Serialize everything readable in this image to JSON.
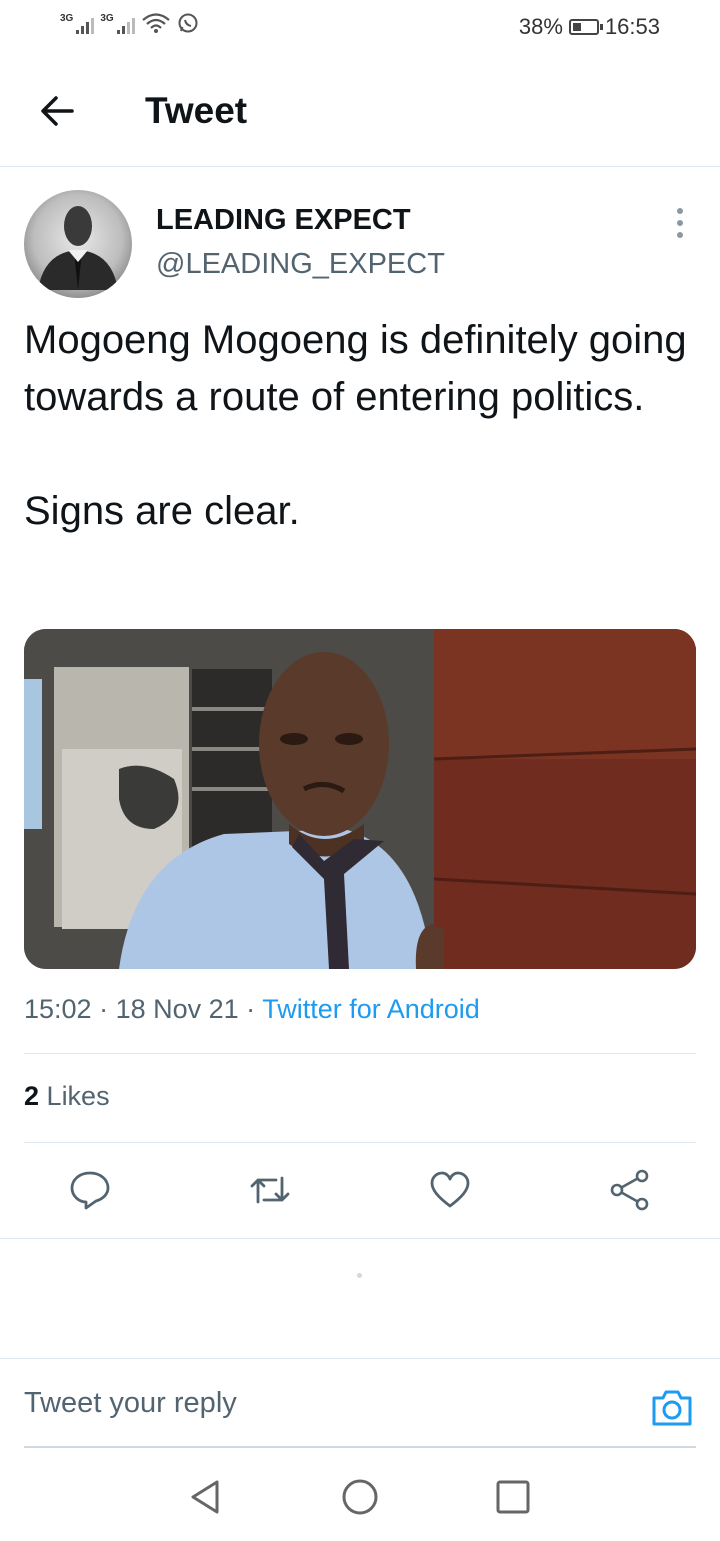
{
  "status_bar": {
    "signal1_label": "3G",
    "signal2_label": "3G",
    "battery_percent_text": "38%",
    "battery_level": 0.38,
    "time": "16:53"
  },
  "header": {
    "title": "Tweet"
  },
  "tweet": {
    "display_name": "LEADING EXPECT",
    "handle": "@LEADING_EXPECT",
    "text_line1": "Mogoeng Mogoeng is definitely going towards a route of entering politics.",
    "text_line2": "Signs are clear.",
    "time": "15:02",
    "date": "18 Nov 21",
    "source": "Twitter for Android",
    "likes_count": "2",
    "likes_label": "Likes"
  },
  "reply": {
    "placeholder": "Tweet your reply"
  },
  "icons": {
    "back": "arrow-left-icon",
    "more": "more-vertical-icon",
    "reply": "reply-icon",
    "retweet": "retweet-icon",
    "like": "heart-icon",
    "share": "share-icon",
    "camera": "camera-icon"
  },
  "colors": {
    "accent": "#1d9bf0",
    "text": "#0f1419",
    "secondary_text": "#536471",
    "divider": "#e1e8ed"
  }
}
